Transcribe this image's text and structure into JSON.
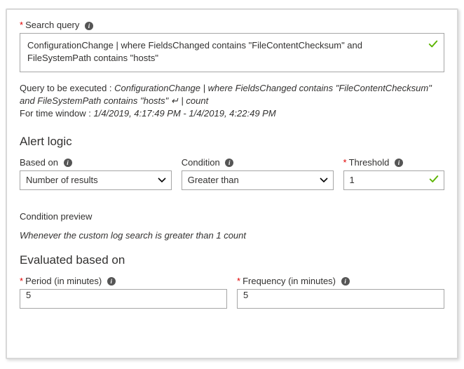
{
  "searchQuery": {
    "label": "Search query",
    "value": "ConfigurationChange | where FieldsChanged contains \"FileContentChecksum\" and FileSystemPath contains \"hosts\""
  },
  "executed": {
    "prefix": "Query to be executed : ",
    "queryItalic": "ConfigurationChange | where FieldsChanged contains \"FileContentChecksum\" and FileSystemPath contains \"hosts\" ",
    "countSuffix": "| count",
    "timePrefix": "For time window : ",
    "timeValue": "1/4/2019, 4:17:49 PM - 1/4/2019, 4:22:49 PM"
  },
  "alertLogic": {
    "title": "Alert logic",
    "basedOn": {
      "label": "Based on",
      "value": "Number of results"
    },
    "condition": {
      "label": "Condition",
      "value": "Greater than"
    },
    "threshold": {
      "label": "Threshold",
      "value": "1"
    }
  },
  "conditionPreview": {
    "title": "Condition preview",
    "text": "Whenever the custom log search is greater than 1 count"
  },
  "evaluated": {
    "title": "Evaluated based on",
    "period": {
      "label": "Period (in minutes)",
      "value": "5"
    },
    "frequency": {
      "label": "Frequency (in minutes)",
      "value": "5"
    }
  }
}
